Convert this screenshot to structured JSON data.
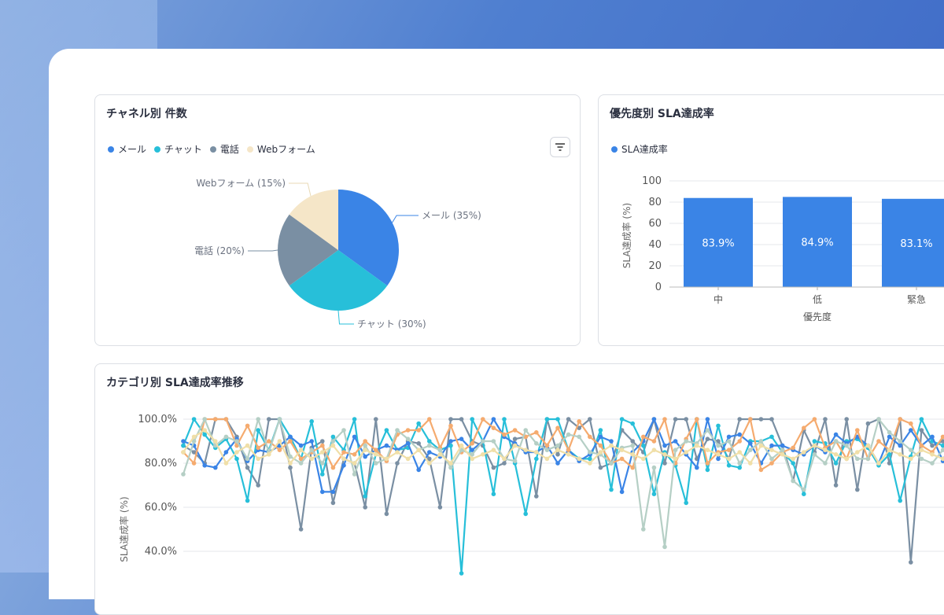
{
  "colors": {
    "mail": "#3a84e6",
    "chat": "#27bfd9",
    "phone": "#7a8fa3",
    "web": "#f5e6c8",
    "bar": "#3a84e6"
  },
  "pie_card": {
    "title": "チャネル別 件数",
    "legend": [
      {
        "label": "メール",
        "color": "#3a84e6"
      },
      {
        "label": "チャット",
        "color": "#27bfd9"
      },
      {
        "label": "電話",
        "color": "#7a8fa3"
      },
      {
        "label": "Webフォーム",
        "color": "#f5e6c8"
      }
    ],
    "filter_icon": "filter-icon"
  },
  "bar_card": {
    "title": "優先度別 SLA達成率",
    "legend": [
      {
        "label": "SLA達成率",
        "color": "#3a84e6"
      }
    ]
  },
  "line_card": {
    "title": "カテゴリ別 SLA達成率推移"
  },
  "chart_data": [
    {
      "type": "pie",
      "slices": [
        {
          "label": "メール (35%)",
          "value": 35,
          "color": "#3a84e6"
        },
        {
          "label": "チャット (30%)",
          "value": 30,
          "color": "#27bfd9"
        },
        {
          "label": "電話 (20%)",
          "value": 20,
          "color": "#7a8fa3"
        },
        {
          "label": "Webフォーム (15%)",
          "value": 15,
          "color": "#f5e6c8"
        }
      ]
    },
    {
      "type": "bar",
      "categories": [
        "中",
        "低",
        "緊急"
      ],
      "values": [
        83.9,
        84.9,
        83.1
      ],
      "data_labels": [
        "83.9%",
        "84.9%",
        "83.1%"
      ],
      "xlabel": "優先度",
      "ylabel": "SLA達成率 (%)",
      "ylim": [
        0,
        100
      ],
      "yticks": [
        "0",
        "20",
        "40",
        "60",
        "80",
        "100"
      ],
      "grid": true
    },
    {
      "type": "line",
      "ylabel": "SLA達成率 (%)",
      "ylim": [
        40,
        100
      ],
      "yticks": [
        "40.0%",
        "60.0%",
        "80.0%",
        "100.0%"
      ],
      "grid": true,
      "series": [
        {
          "color": "#7a8fa3",
          "values": [
            88,
            85,
            80,
            100,
            100,
            92,
            78,
            70,
            100,
            100,
            78,
            50,
            87,
            90,
            62,
            82,
            80,
            60,
            100,
            57,
            80,
            90,
            89,
            82,
            60,
            100,
            100,
            90,
            88,
            78,
            80,
            91,
            92,
            65,
            100,
            84,
            100,
            96,
            100,
            78,
            80,
            95,
            90,
            85,
            100,
            80,
            100,
            100,
            82,
            91,
            90,
            82,
            100,
            100,
            100,
            100,
            88,
            72,
            95,
            85,
            100,
            70,
            100,
            68,
            98,
            100,
            80,
            100,
            35,
            95,
            88,
            90,
            84,
            80
          ]
        },
        {
          "color": "#27bfd9",
          "values": [
            88,
            100,
            93,
            87,
            91,
            82,
            63,
            95,
            86,
            100,
            92,
            82,
            99,
            75,
            92,
            86,
            100,
            65,
            84,
            95,
            86,
            87,
            98,
            90,
            86,
            88,
            30,
            100,
            90,
            66,
            100,
            80,
            57,
            82,
            100,
            100,
            86,
            82,
            82,
            95,
            68,
            100,
            98,
            88,
            66,
            85,
            79,
            62,
            100,
            77,
            97,
            79,
            78,
            90,
            90,
            92,
            85,
            80,
            66,
            90,
            89,
            80,
            90,
            91,
            87,
            79,
            84,
            63,
            83,
            100,
            90,
            88,
            87,
            95
          ]
        },
        {
          "color": "#3a84e6",
          "values": [
            90,
            88,
            79,
            78,
            85,
            91,
            81,
            86,
            85,
            88,
            92,
            88,
            90,
            67,
            67,
            79,
            92,
            83,
            86,
            88,
            86,
            89,
            77,
            85,
            83,
            90,
            91,
            86,
            90,
            100,
            92,
            89,
            85,
            85,
            88,
            80,
            86,
            81,
            84,
            92,
            90,
            67,
            85,
            90,
            100,
            88,
            90,
            84,
            78,
            100,
            82,
            92,
            93,
            89,
            80,
            88,
            88,
            86,
            84,
            88,
            85,
            93,
            89,
            92,
            88,
            80,
            92,
            88,
            95,
            88,
            92,
            81,
            93,
            88
          ]
        },
        {
          "color": "#f5ab6f",
          "values": [
            85,
            80,
            100,
            100,
            100,
            88,
            97,
            87,
            90,
            86,
            90,
            82,
            85,
            88,
            78,
            85,
            84,
            90,
            86,
            81,
            93,
            95,
            95,
            100,
            87,
            97,
            85,
            89,
            100,
            96,
            93,
            95,
            92,
            94,
            88,
            96,
            86,
            99,
            92,
            88,
            80,
            82,
            78,
            92,
            90,
            100,
            80,
            91,
            100,
            80,
            85,
            86,
            90,
            100,
            77,
            80,
            85,
            87,
            96,
            100,
            87,
            90,
            82,
            95,
            82,
            90,
            86,
            100,
            98,
            88,
            85,
            92,
            88,
            90
          ]
        },
        {
          "color": "#b5cfc5",
          "values": [
            75,
            90,
            100,
            88,
            92,
            90,
            82,
            100,
            85,
            100,
            83,
            80,
            86,
            80,
            90,
            95,
            75,
            88,
            80,
            82,
            95,
            91,
            86,
            88,
            86,
            78,
            86,
            84,
            90,
            90,
            82,
            81,
            95,
            89,
            86,
            88,
            93,
            92,
            85,
            84,
            80,
            87,
            88,
            50,
            78,
            42,
            86,
            90,
            89,
            95,
            88,
            90,
            80,
            86,
            90,
            82,
            86,
            72,
            68,
            84,
            80,
            90,
            88,
            82,
            82,
            100,
            94,
            90,
            86,
            82,
            80,
            86,
            84,
            82
          ]
        },
        {
          "color": "#f0dfa8",
          "values": [
            85,
            92,
            95,
            90,
            80,
            85,
            88,
            82,
            84,
            90,
            80,
            86,
            82,
            85,
            88,
            82,
            80,
            86,
            84,
            82,
            85,
            82,
            86,
            80,
            84,
            80,
            88,
            82,
            84,
            86,
            82,
            88,
            86,
            85,
            82,
            86,
            84,
            82,
            80,
            85,
            88,
            86,
            84,
            82,
            86,
            84,
            82,
            85,
            88,
            86,
            84,
            82,
            85,
            80,
            88,
            86,
            84,
            82,
            85,
            88,
            86,
            84,
            82,
            85,
            88,
            80,
            86,
            84,
            82,
            86,
            84,
            82,
            80,
            85
          ]
        }
      ]
    }
  ]
}
